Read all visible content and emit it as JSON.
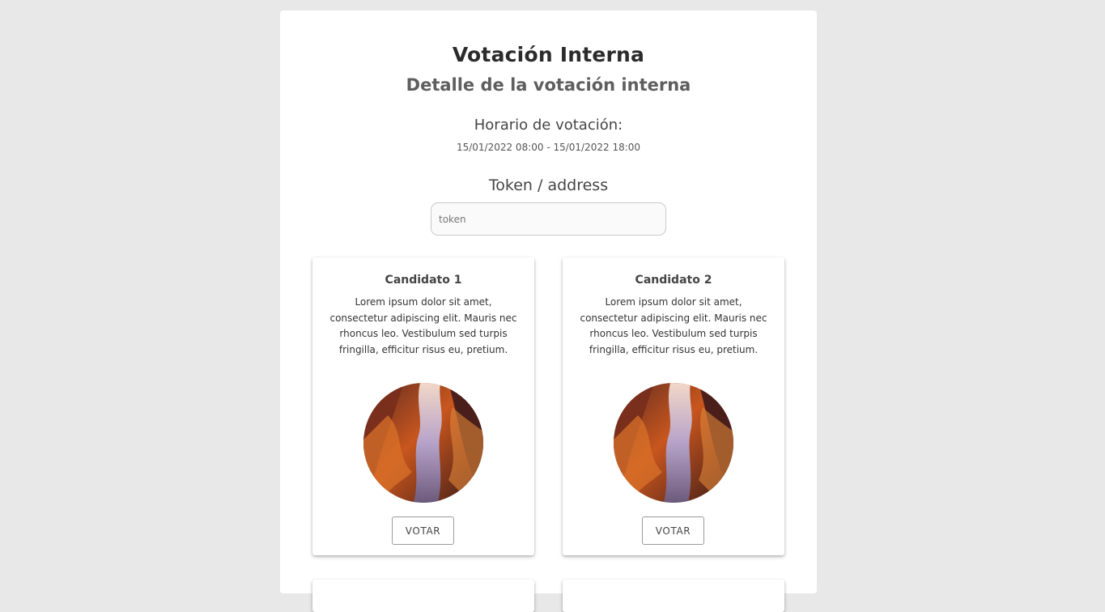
{
  "header": {
    "title": "Votación Interna",
    "subtitle": "Detalle de la votación interna"
  },
  "schedule": {
    "label": "Horario de votación:",
    "value": "15/01/2022 08:00 - 15/01/2022 18:00"
  },
  "token": {
    "label": "Token / address",
    "placeholder": "token",
    "value": ""
  },
  "candidates": [
    {
      "name": "Candidato 1",
      "description": "Lorem ipsum dolor sit amet, consectetur adipiscing elit. Mauris nec rhoncus leo. Vestibulum sed turpis fringilla, efficitur risus eu, pretium.",
      "photo_icon": "canyon-photo",
      "vote_label": "VOTAR"
    },
    {
      "name": "Candidato 2",
      "description": "Lorem ipsum dolor sit amet, consectetur adipiscing elit. Mauris nec rhoncus leo. Vestibulum sed turpis fringilla, efficitur risus eu, pretium.",
      "photo_icon": "canyon-photo",
      "vote_label": "VOTAR"
    }
  ],
  "colors": {
    "background": "#e8e8e8",
    "panel": "#ffffff",
    "canyon_orange": "#c8561e",
    "canyon_dark": "#3a1a18",
    "canyon_light": "#b7a3c9"
  }
}
